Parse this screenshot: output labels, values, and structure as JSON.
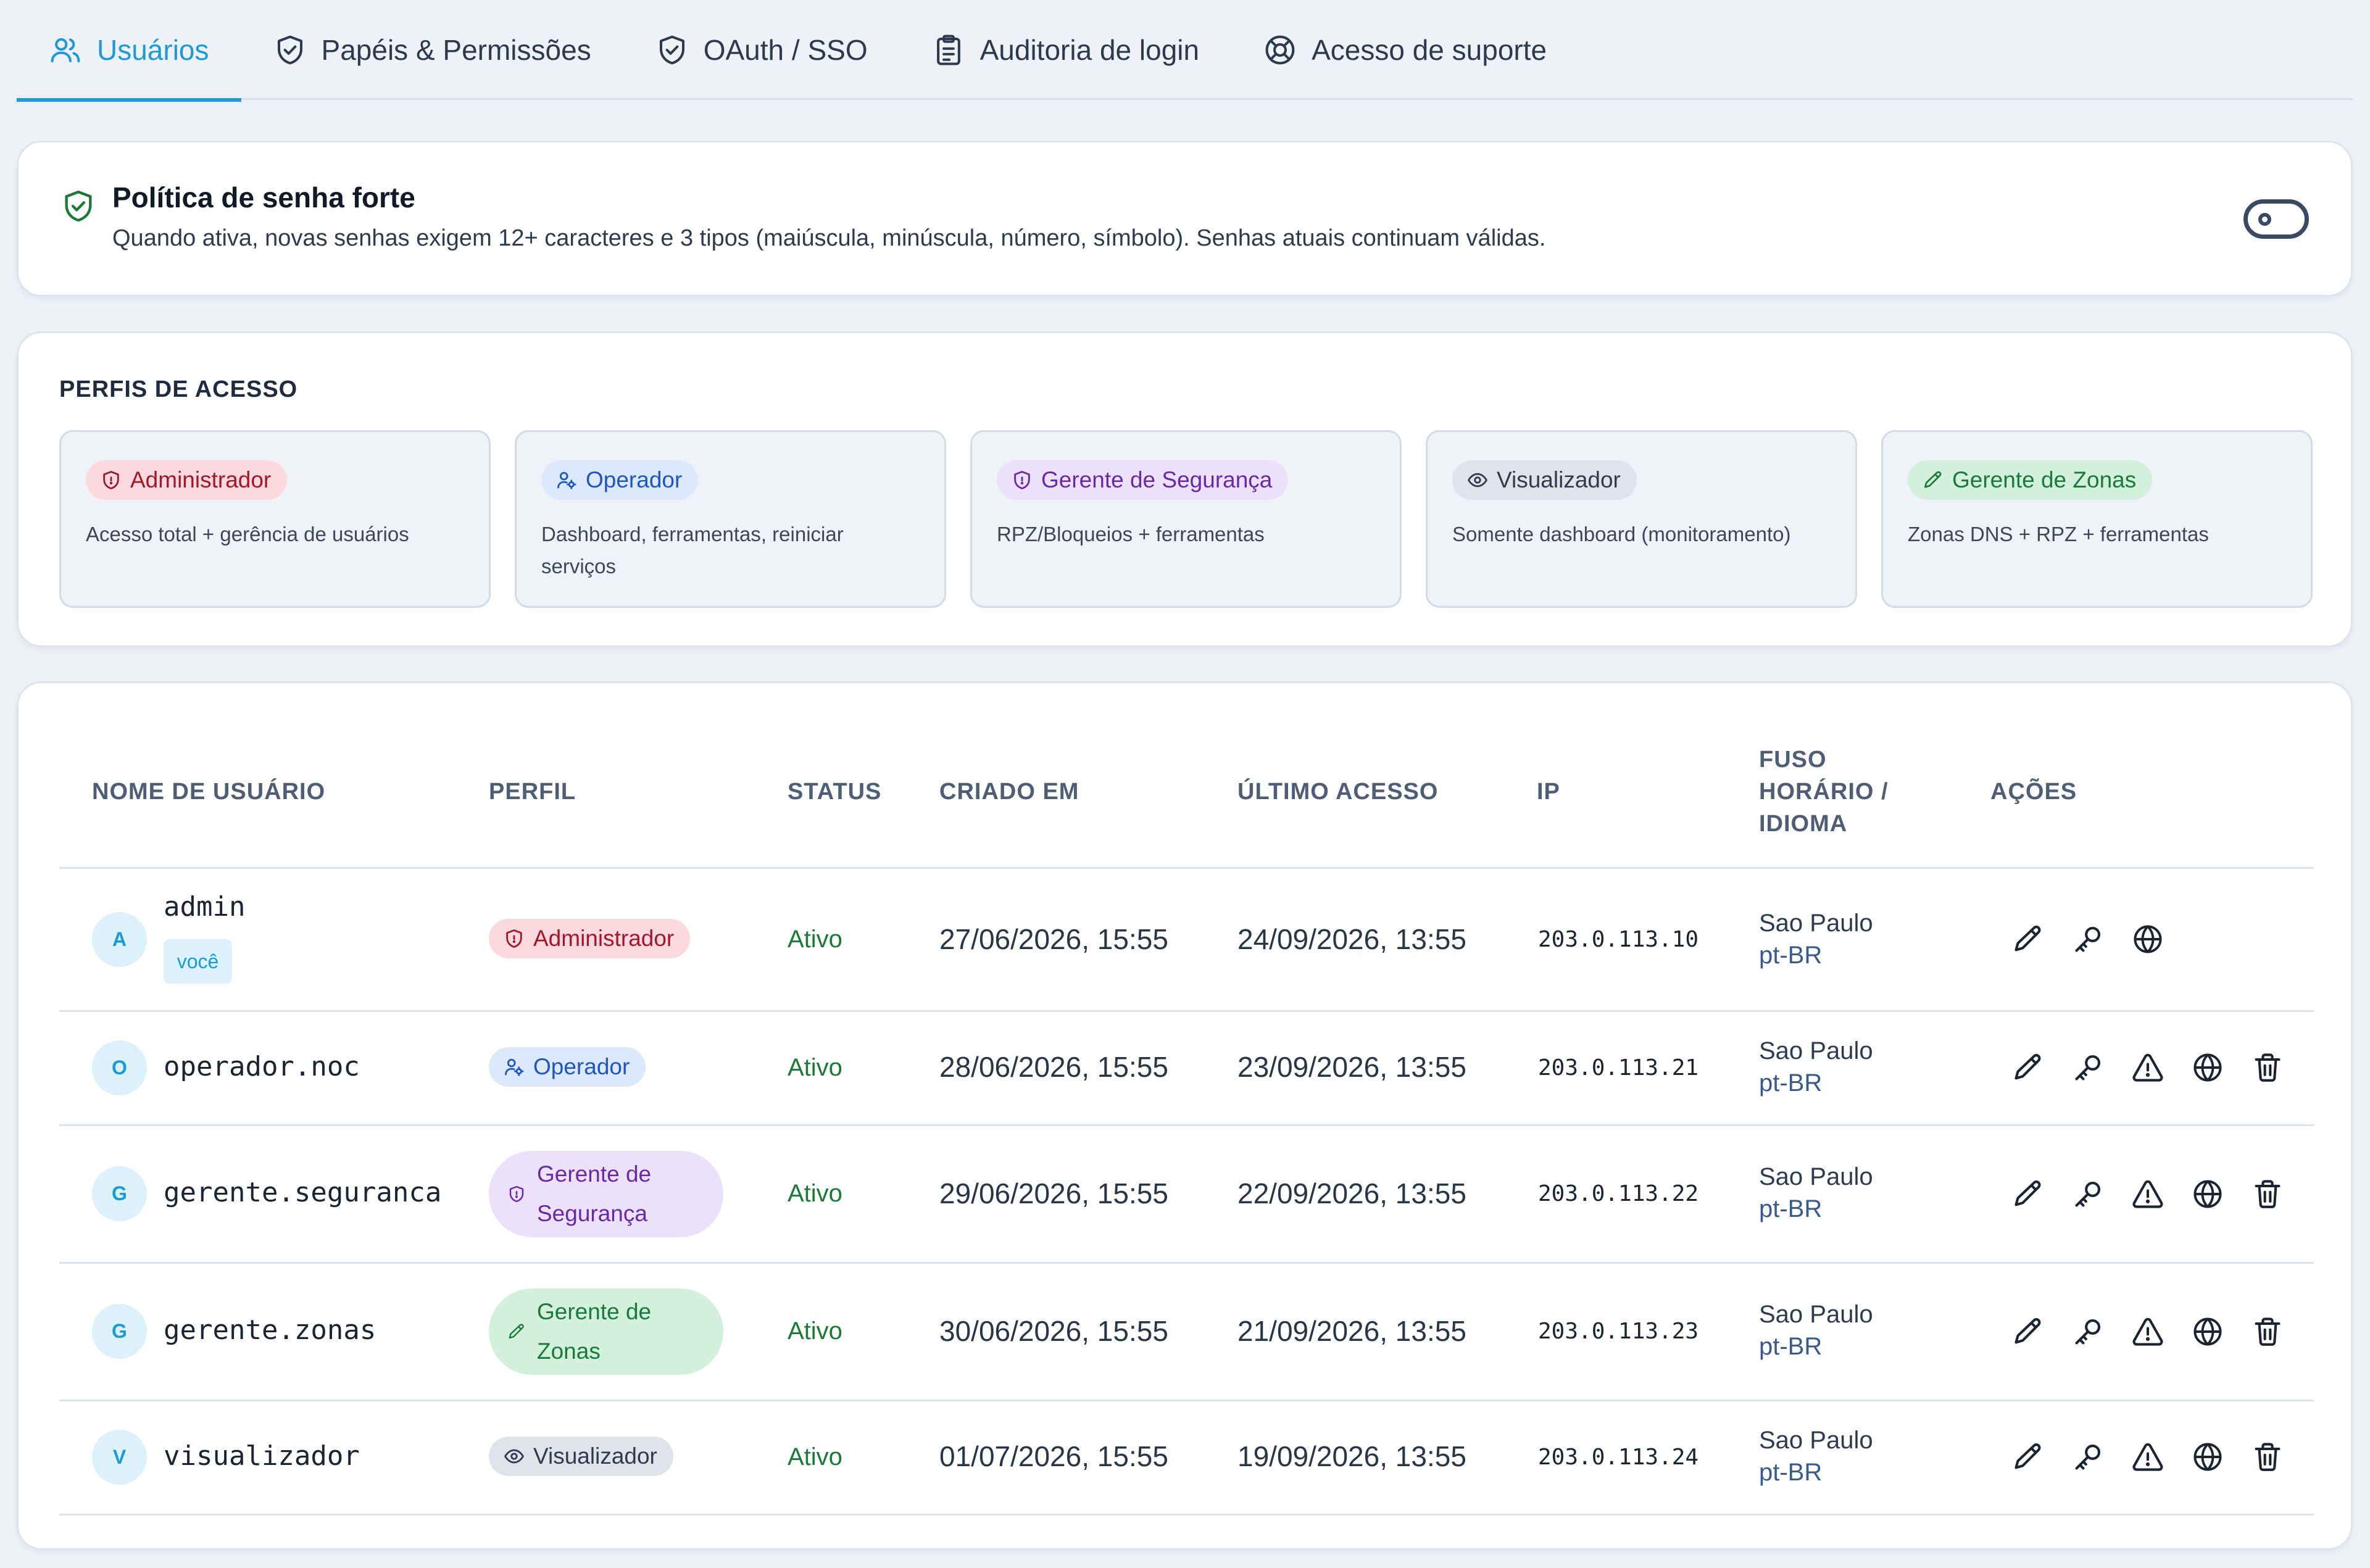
{
  "tabs": [
    {
      "label": "Usuários",
      "icon": "users-icon",
      "active": true
    },
    {
      "label": "Papéis & Permissões",
      "icon": "shield-check-icon"
    },
    {
      "label": "OAuth / SSO",
      "icon": "shield-check-icon"
    },
    {
      "label": "Auditoria de login",
      "icon": "clipboard-icon"
    },
    {
      "label": "Acesso de suporte",
      "icon": "lifebuoy-icon"
    }
  ],
  "policy": {
    "title": "Política de senha forte",
    "description": "Quando ativa, novas senhas exigem 12+ caracteres e 3 tipos (maiúscula, minúscula, número, símbolo). Senhas atuais continuam válidas.",
    "enabled": false
  },
  "profiles": {
    "heading": "PERFIS DE ACESSO",
    "items": [
      {
        "label": "Administrador",
        "description": "Acesso total + gerência de usuários",
        "icon": "shield-icon"
      },
      {
        "label": "Operador",
        "description": "Dashboard, ferramentas, reiniciar serviços",
        "icon": "user-cog-icon"
      },
      {
        "label": "Gerente de Segurança",
        "description": "RPZ/Bloqueios + ferramentas",
        "icon": "shield-icon"
      },
      {
        "label": "Visualizador",
        "description": "Somente dashboard (monitoramento)",
        "icon": "eye-icon"
      },
      {
        "label": "Gerente de Zonas",
        "description": "Zonas DNS + RPZ + ferramentas",
        "icon": "pencil-icon"
      }
    ]
  },
  "table": {
    "headers": {
      "username": "NOME DE USUÁRIO",
      "role": "PERFIL",
      "status": "STATUS",
      "created": "CRIADO EM",
      "last_access": "ÚLTIMO ACESSO",
      "ip": "IP",
      "tz_line1": "FUSO",
      "tz_line2": "HORÁRIO /",
      "tz_line3": "IDIOMA",
      "actions": "AÇÕES"
    },
    "rows": [
      {
        "initial": "A",
        "username": "admin",
        "you": "você",
        "role": "Administrador",
        "status": "Ativo",
        "created": "27/06/2026, 15:55",
        "last_access": "24/09/2026, 13:55",
        "ip": "203.0.113.10",
        "tz": "Sao Paulo",
        "lang": "pt-BR"
      },
      {
        "initial": "O",
        "username": "operador.noc",
        "role": "Operador",
        "status": "Ativo",
        "created": "28/06/2026, 15:55",
        "last_access": "23/09/2026, 13:55",
        "ip": "203.0.113.21",
        "tz": "Sao Paulo",
        "lang": "pt-BR"
      },
      {
        "initial": "G",
        "username": "gerente.seguranca",
        "role_line1": "Gerente de",
        "role_line2": "Segurança",
        "status": "Ativo",
        "created": "29/06/2026, 15:55",
        "last_access": "22/09/2026, 13:55",
        "ip": "203.0.113.22",
        "tz": "Sao Paulo",
        "lang": "pt-BR"
      },
      {
        "initial": "G",
        "username": "gerente.zonas",
        "role_line1": "Gerente de",
        "role_line2": "Zonas",
        "status": "Ativo",
        "created": "30/06/2026, 15:55",
        "last_access": "21/09/2026, 13:55",
        "ip": "203.0.113.23",
        "tz": "Sao Paulo",
        "lang": "pt-BR"
      },
      {
        "initial": "V",
        "username": "visualizador",
        "role": "Visualizador",
        "status": "Ativo",
        "created": "01/07/2026, 15:55",
        "last_access": "19/09/2026, 13:55",
        "ip": "203.0.113.24",
        "tz": "Sao Paulo",
        "lang": "pt-BR"
      }
    ]
  },
  "colors": {
    "accent": "#1e9ad6",
    "status_active": "#1c7a37",
    "admin": "#a3172b",
    "operator": "#1f56c2",
    "security": "#6a2aa8",
    "zones": "#197a3b"
  }
}
